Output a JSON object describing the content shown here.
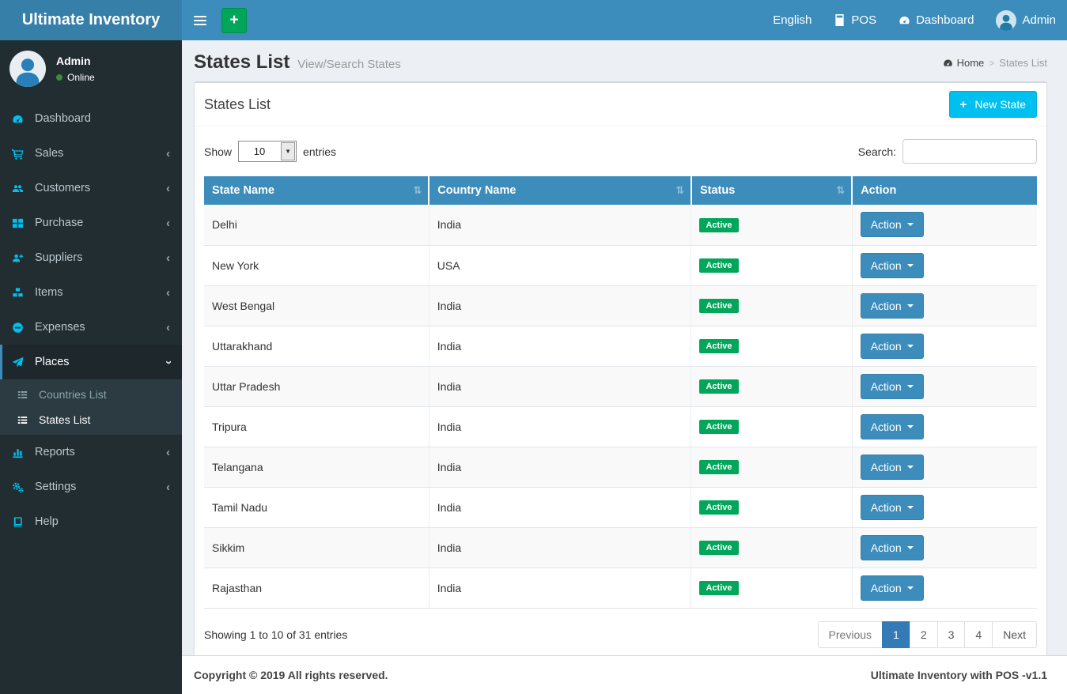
{
  "brand": {
    "title": "Ultimate Inventory"
  },
  "navbar": {
    "language": "English",
    "pos_label": "POS",
    "dashboard_label": "Dashboard",
    "user_label": "Admin",
    "add_button": "+"
  },
  "sidebar": {
    "user": {
      "name": "Admin",
      "status": "Online"
    },
    "items": [
      {
        "label": "Dashboard"
      },
      {
        "label": "Sales"
      },
      {
        "label": "Customers"
      },
      {
        "label": "Purchase"
      },
      {
        "label": "Suppliers"
      },
      {
        "label": "Items"
      },
      {
        "label": "Expenses"
      },
      {
        "label": "Places"
      },
      {
        "label": "Reports"
      },
      {
        "label": "Settings"
      },
      {
        "label": "Help"
      }
    ],
    "places_submenu": [
      {
        "label": "Countries List"
      },
      {
        "label": "States List"
      }
    ]
  },
  "page": {
    "title": "States List",
    "subtitle": "View/Search States",
    "breadcrumb": {
      "home": "Home",
      "current": "States List"
    }
  },
  "panel": {
    "title": "States List",
    "new_button_label": "New State"
  },
  "controls": {
    "show_label": "Show",
    "entries_label": "entries",
    "page_length": "10",
    "search_label": "Search:",
    "search_value": ""
  },
  "table": {
    "columns": [
      "State Name",
      "Country Name",
      "Status",
      "Action"
    ],
    "action_label": "Action",
    "rows": [
      {
        "state": "Delhi",
        "country": "India",
        "status": "Active"
      },
      {
        "state": "New York",
        "country": "USA",
        "status": "Active"
      },
      {
        "state": "West Bengal",
        "country": "India",
        "status": "Active"
      },
      {
        "state": "Uttarakhand",
        "country": "India",
        "status": "Active"
      },
      {
        "state": "Uttar Pradesh",
        "country": "India",
        "status": "Active"
      },
      {
        "state": "Tripura",
        "country": "India",
        "status": "Active"
      },
      {
        "state": "Telangana",
        "country": "India",
        "status": "Active"
      },
      {
        "state": "Tamil Nadu",
        "country": "India",
        "status": "Active"
      },
      {
        "state": "Sikkim",
        "country": "India",
        "status": "Active"
      },
      {
        "state": "Rajasthan",
        "country": "India",
        "status": "Active"
      }
    ]
  },
  "pagination": {
    "info": "Showing 1 to 10 of 31 entries",
    "previous": "Previous",
    "pages": [
      "1",
      "2",
      "3",
      "4"
    ],
    "active_page": "1",
    "next": "Next"
  },
  "footer": {
    "copyright": "Copyright © 2019 All rights reserved.",
    "version": "Ultimate Inventory with POS -v1.1"
  },
  "icons": {
    "hamburger-icon": "three-bars",
    "plus-icon": "+",
    "calculator-icon": "calculator grid",
    "tachometer-icon": "speedometer gauge",
    "user-avatar-icon": "person silhouette in circle",
    "cart-icon": "shopping cart",
    "users-icon": "group of people",
    "grid-icon": "four squares",
    "user-plus-icon": "person with plus",
    "cubes-icon": "stacked boxes",
    "minus-circle-icon": "circle with minus",
    "paper-plane-icon": "send plane",
    "list-icon": "bulleted list",
    "bar-chart-icon": "bar chart",
    "gears-icon": "settings gears",
    "book-icon": "book",
    "sort-icon": "⇅",
    "chevron-left-icon": "‹",
    "chevron-down-icon": "v",
    "caret-down-icon": "▾",
    "online-dot-icon": "green dot"
  },
  "colors": {
    "navbar": "#3c8dbc",
    "logo_bg": "#367fa9",
    "sidebar_bg": "#222d32",
    "submenu_bg": "#2c3b41",
    "active_item_bg": "#1e282c",
    "icon_accent": "#00c0ef",
    "success_green": "#00a65a",
    "table_header": "#3c8dbc",
    "pagination_active": "#337ab7",
    "body_bg": "#ecf0f5"
  }
}
